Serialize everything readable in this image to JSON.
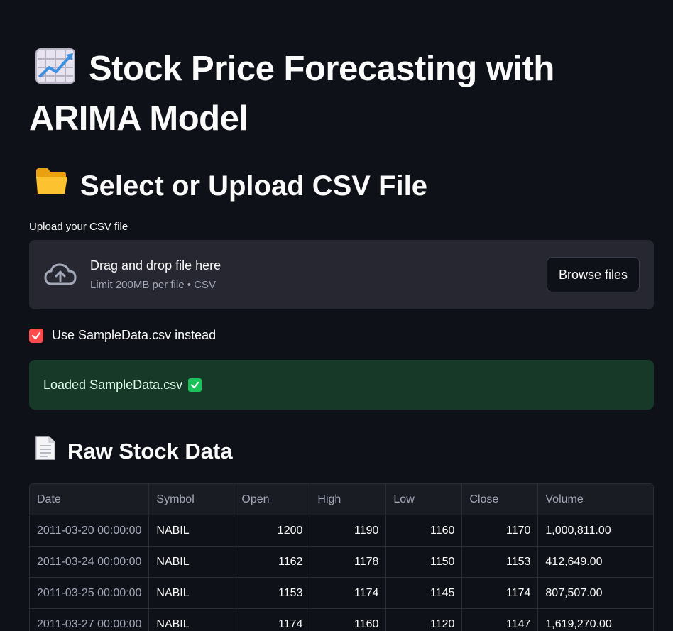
{
  "page": {
    "title": "Stock Price Forecasting with ARIMA Model",
    "title_icon": "chart-increasing-emoji"
  },
  "upload_section": {
    "heading": "Select or Upload CSV File",
    "heading_icon": "folder-emoji",
    "label": "Upload your CSV file",
    "dropzone_main": "Drag and drop file here",
    "dropzone_sub": "Limit 200MB per file • CSV",
    "browse_label": "Browse files",
    "upload_icon": "cloud-upload-icon"
  },
  "sample_checkbox": {
    "label": "Use SampleData.csv instead",
    "checked": true,
    "color": "#ff4b4b"
  },
  "success_message": {
    "text": "Loaded SampleData.csv",
    "icon": "check-mark-emoji",
    "color": "#173928"
  },
  "raw_data": {
    "heading": "Raw Stock Data",
    "heading_icon": "page-emoji",
    "columns": [
      "Date",
      "Symbol",
      "Open",
      "High",
      "Low",
      "Close",
      "Volume"
    ],
    "rows": [
      [
        "2011-03-20 00:00:00",
        "NABIL",
        "1200",
        "1190",
        "1160",
        "1170",
        "1,000,811.00"
      ],
      [
        "2011-03-24 00:00:00",
        "NABIL",
        "1162",
        "1178",
        "1150",
        "1153",
        "412,649.00"
      ],
      [
        "2011-03-25 00:00:00",
        "NABIL",
        "1153",
        "1174",
        "1145",
        "1174",
        "807,507.00"
      ],
      [
        "2011-03-27 00:00:00",
        "NABIL",
        "1174",
        "1160",
        "1120",
        "1147",
        "1,619,270.00"
      ]
    ]
  }
}
